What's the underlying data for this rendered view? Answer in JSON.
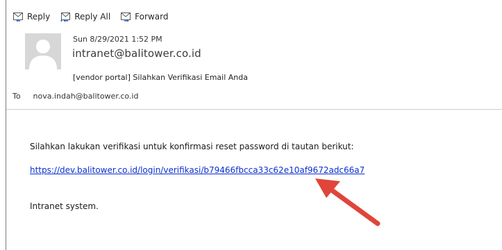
{
  "toolbar": {
    "reply_label": "Reply",
    "reply_all_label": "Reply All",
    "forward_label": "Forward"
  },
  "message": {
    "date": "Sun 8/29/2021 1:52 PM",
    "from": "intranet@balitower.co.id",
    "subject": "[vendor portal] Silahkan Verifikasi Email Anda",
    "to_label": "To",
    "to": "nova.indah@balitower.co.id"
  },
  "body": {
    "instruction": "Silahkan lakukan verifikasi untuk konfirmasi reset password di tautan berikut:",
    "link": "https://dev.balitower.co.id/login/verifikasi/b79466fbcca33c62e10af9672adc66a7",
    "signature": "Intranet system."
  },
  "colors": {
    "link": "#0b2fd0",
    "arrow": "#e0453a",
    "icon_blue": "#2f6fb8"
  }
}
